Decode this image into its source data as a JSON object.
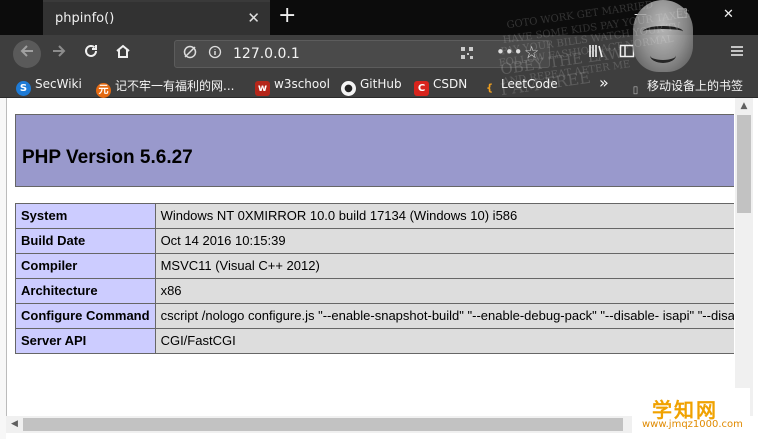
{
  "browser": {
    "tab_title": "phpinfo()",
    "tab_close": "✕",
    "new_tab": "+",
    "window_controls": {
      "minimize": "—",
      "maximize": "☐",
      "close": "✕"
    },
    "url": "127.0.0.1",
    "icons": [
      "back-icon",
      "forward-icon",
      "reload-icon",
      "home-icon",
      "tracking-protection-icon",
      "info-icon",
      "qr-code-icon",
      "more-icon",
      "bookmark-star-icon",
      "library-icon",
      "sidebar-icon",
      "menu-icon"
    ]
  },
  "bookmarks": [
    {
      "label": "SecWiki",
      "icon": "secwiki-icon",
      "color": "#1e7bd6"
    },
    {
      "label": "记不牢一有福利的网...",
      "icon": "fire-icon",
      "color": "#e46a12"
    },
    {
      "label": "w3school",
      "icon": "w3school-icon",
      "color": "#b5261a"
    },
    {
      "label": "GitHub",
      "icon": "github-icon",
      "color": "#222222"
    },
    {
      "label": "CSDN",
      "icon": "csdn-icon",
      "color": "#d7241d"
    },
    {
      "label": "LeetCode",
      "icon": "leetcode-icon",
      "color": "#f0a020"
    },
    {
      "label": "移动设备上的书签",
      "icon": "mobile-bookmarks-icon",
      "color": "#999999"
    }
  ],
  "overflow_chevron": "»",
  "theme": {
    "lines": [
      "GOTO WORK GET MARRIED",
      "HAVE SOME KIDS PAY YOUR TAXES",
      "PAY YOUR BILLS WATCH YOUR TV",
      "FOLLOW FASHION ACT NORMAL",
      "OBEY THE LAW",
      "AND REPEAT AFTER ME",
      "I AM FREE"
    ]
  },
  "php": {
    "version_heading": "PHP Version 5.6.27",
    "rows": [
      {
        "key": "System",
        "value": "Windows NT 0XMIRROR 10.0 build 17134 (Windows 10) i586"
      },
      {
        "key": "Build Date",
        "value": "Oct 14 2016 10:15:39"
      },
      {
        "key": "Compiler",
        "value": "MSVC11 (Visual C++ 2012)"
      },
      {
        "key": "Architecture",
        "value": "x86"
      },
      {
        "key": "Configure Command",
        "value": "cscript /nologo configure.js \"--enable-snapshot-build\" \"--enable-debug-pack\" \"--disable-\nisapi\" \"--disable-nsapi\" \"--without-mssql\" \"--without-pdo-mssql\" \"--without-pi3web\" \"--with-pdo-\noci=c:\\php-sdk\\oracle\\x86\\instantclient_12_1\\sdk,shared\" \"--with-oci8-12c=c:\\php-sdk\\oracle\n\\x86\\instantclient_12_1\\sdk,shared\" \"--with-enchant=shared\" \"--enable-object-out-dir=../obj/\" \"--enable-\ncom-dotnet=shared\" \"--with-mcrypt=static\" \"--without-analyzer\" \"--with-pgo\""
      },
      {
        "key": "Server API",
        "value": "CGI/FastCGI"
      }
    ]
  },
  "watermark": {
    "main": "学知网",
    "sub": "www.jmqz1000.com"
  }
}
